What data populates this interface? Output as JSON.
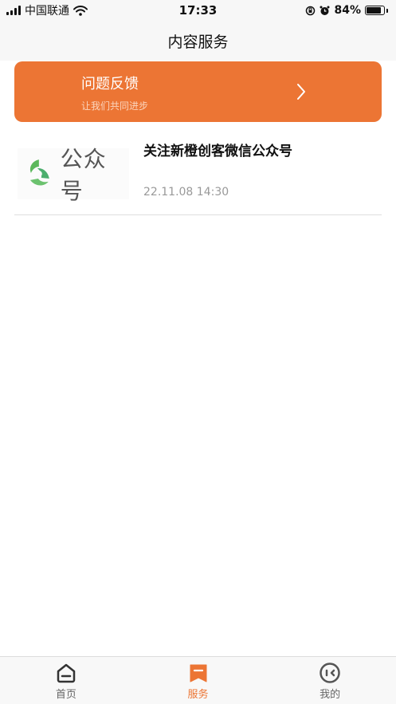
{
  "status_bar": {
    "carrier": "中国联通",
    "time": "17:33",
    "battery_text": "84%",
    "battery_level": 0.84
  },
  "header": {
    "title": "内容服务"
  },
  "feedback": {
    "title": "问题反馈",
    "subtitle": "让我们共同进步",
    "color": "#ec7534"
  },
  "articles": [
    {
      "thumb_text": "公众号",
      "title": "关注新橙创客微信公众号",
      "time": "22.11.08 14:30"
    }
  ],
  "tab_bar": {
    "active_color": "#ec7534",
    "items": [
      {
        "label": "首页",
        "icon": "home-icon"
      },
      {
        "label": "服务",
        "icon": "service-icon"
      },
      {
        "label": "我的",
        "icon": "profile-icon"
      }
    ]
  }
}
